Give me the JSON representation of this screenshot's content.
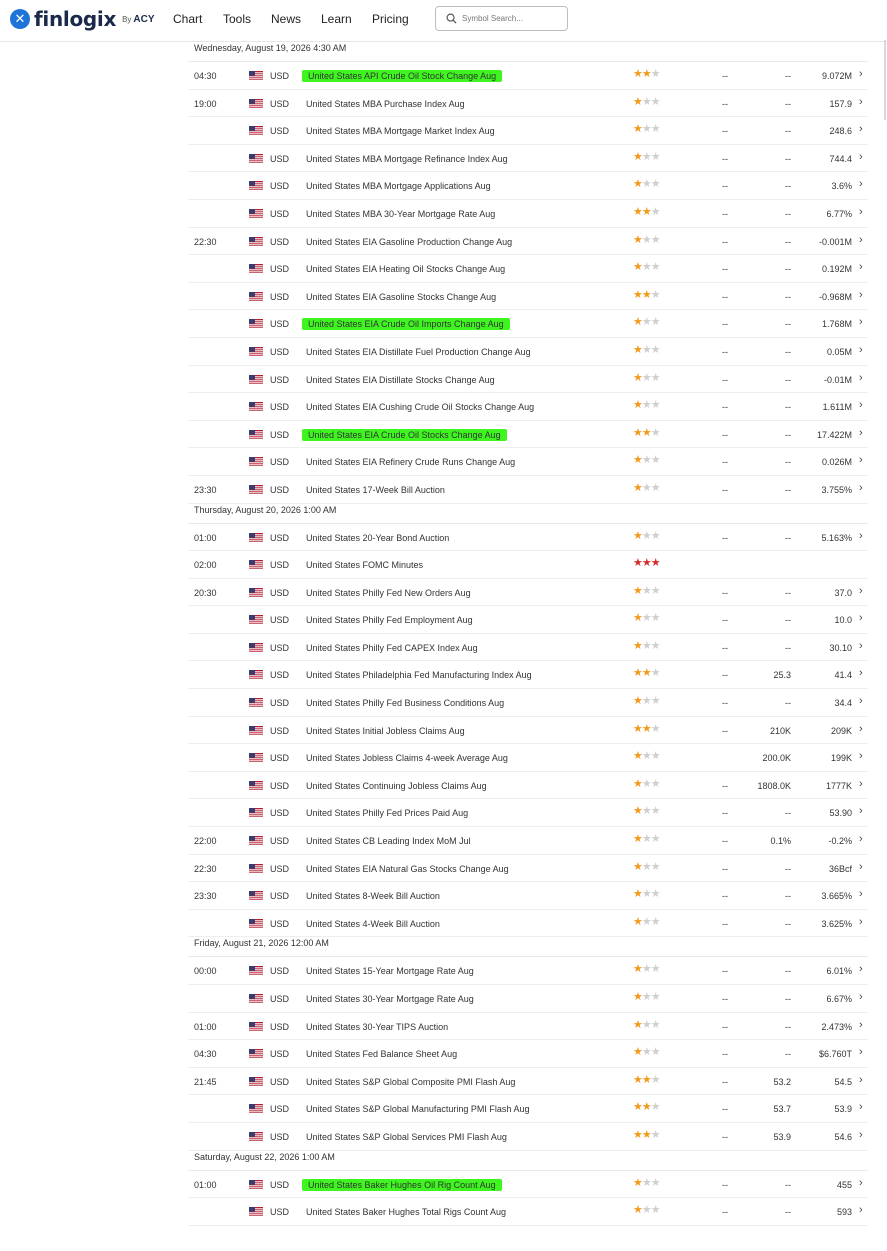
{
  "header": {
    "brand": "finlogix",
    "brand_by": "By",
    "brand_partner": "ACY",
    "nav": [
      "Chart",
      "Tools",
      "News",
      "Learn",
      "Pricing"
    ],
    "search_placeholder": "Symbol Search..."
  },
  "days": [
    {
      "title": "Wednesday, August 19, 2026 4:30 AM",
      "rows": [
        {
          "time": "04:30",
          "cur": "USD",
          "event": "United States API Crude Oil Stock Change Aug",
          "stars": 2,
          "actual": "--",
          "forecast": "--",
          "previous": "9.072M",
          "hl": true
        },
        {
          "time": "19:00",
          "cur": "USD",
          "event": "United States MBA Purchase Index Aug",
          "stars": 1,
          "actual": "--",
          "forecast": "--",
          "previous": "157.9"
        },
        {
          "time": "",
          "cur": "USD",
          "event": "United States MBA Mortgage Market Index Aug",
          "stars": 1,
          "actual": "--",
          "forecast": "--",
          "previous": "248.6"
        },
        {
          "time": "",
          "cur": "USD",
          "event": "United States MBA Mortgage Refinance Index Aug",
          "stars": 1,
          "actual": "--",
          "forecast": "--",
          "previous": "744.4"
        },
        {
          "time": "",
          "cur": "USD",
          "event": "United States MBA Mortgage Applications Aug",
          "stars": 1,
          "actual": "--",
          "forecast": "--",
          "previous": "3.6%"
        },
        {
          "time": "",
          "cur": "USD",
          "event": "United States MBA 30-Year Mortgage Rate Aug",
          "stars": 2,
          "actual": "--",
          "forecast": "--",
          "previous": "6.77%"
        },
        {
          "time": "22:30",
          "cur": "USD",
          "event": "United States EIA Gasoline Production Change Aug",
          "stars": 1,
          "actual": "--",
          "forecast": "--",
          "previous": "-0.001M"
        },
        {
          "time": "",
          "cur": "USD",
          "event": "United States EIA Heating Oil Stocks Change Aug",
          "stars": 1,
          "actual": "--",
          "forecast": "--",
          "previous": "0.192M"
        },
        {
          "time": "",
          "cur": "USD",
          "event": "United States EIA Gasoline Stocks Change Aug",
          "stars": 2,
          "actual": "--",
          "forecast": "--",
          "previous": "-0.968M"
        },
        {
          "time": "",
          "cur": "USD",
          "event": "United States EIA Crude Oil Imports Change Aug",
          "stars": 1,
          "actual": "--",
          "forecast": "--",
          "previous": "1.768M",
          "hl": true
        },
        {
          "time": "",
          "cur": "USD",
          "event": "United States EIA Distillate Fuel Production Change Aug",
          "stars": 1,
          "actual": "--",
          "forecast": "--",
          "previous": "0.05M"
        },
        {
          "time": "",
          "cur": "USD",
          "event": "United States EIA Distillate Stocks Change Aug",
          "stars": 1,
          "actual": "--",
          "forecast": "--",
          "previous": "-0.01M"
        },
        {
          "time": "",
          "cur": "USD",
          "event": "United States EIA Cushing Crude Oil Stocks Change Aug",
          "stars": 1,
          "actual": "--",
          "forecast": "--",
          "previous": "1.611M"
        },
        {
          "time": "",
          "cur": "USD",
          "event": "United States EIA Crude Oil Stocks Change Aug",
          "stars": 2,
          "actual": "--",
          "forecast": "--",
          "previous": "17.422M",
          "hl": true
        },
        {
          "time": "",
          "cur": "USD",
          "event": "United States EIA Refinery Crude Runs Change Aug",
          "stars": 1,
          "actual": "--",
          "forecast": "--",
          "previous": "0.026M"
        },
        {
          "time": "23:30",
          "cur": "USD",
          "event": "United States 17-Week Bill Auction",
          "stars": 1,
          "actual": "--",
          "forecast": "--",
          "previous": "3.755%"
        }
      ]
    },
    {
      "title": "Thursday, August 20, 2026 1:00 AM",
      "rows": [
        {
          "time": "01:00",
          "cur": "USD",
          "event": "United States 20-Year Bond Auction",
          "stars": 1,
          "actual": "--",
          "forecast": "--",
          "previous": "5.163%"
        },
        {
          "time": "02:00",
          "cur": "USD",
          "event": "United States FOMC Minutes",
          "stars": 3,
          "actual": "",
          "forecast": "",
          "previous": "",
          "nochev": true
        },
        {
          "time": "20:30",
          "cur": "USD",
          "event": "United States Philly Fed New Orders Aug",
          "stars": 1,
          "actual": "--",
          "forecast": "--",
          "previous": "37.0"
        },
        {
          "time": "",
          "cur": "USD",
          "event": "United States Philly Fed Employment Aug",
          "stars": 1,
          "actual": "--",
          "forecast": "--",
          "previous": "10.0"
        },
        {
          "time": "",
          "cur": "USD",
          "event": "United States Philly Fed CAPEX Index Aug",
          "stars": 1,
          "actual": "--",
          "forecast": "--",
          "previous": "30.10"
        },
        {
          "time": "",
          "cur": "USD",
          "event": "United States Philadelphia Fed Manufacturing Index Aug",
          "stars": 2,
          "actual": "--",
          "forecast": "25.3",
          "previous": "41.4"
        },
        {
          "time": "",
          "cur": "USD",
          "event": "United States Philly Fed Business Conditions Aug",
          "stars": 1,
          "actual": "--",
          "forecast": "--",
          "previous": "34.4"
        },
        {
          "time": "",
          "cur": "USD",
          "event": "United States Initial Jobless Claims Aug",
          "stars": 2,
          "actual": "--",
          "forecast": "210K",
          "previous": "209K"
        },
        {
          "time": "",
          "cur": "USD",
          "event": "United States Jobless Claims 4-week Average Aug",
          "stars": 1,
          "actual": "",
          "forecast": "200.0K",
          "previous": "199K"
        },
        {
          "time": "",
          "cur": "USD",
          "event": "United States Continuing Jobless Claims Aug",
          "stars": 1,
          "actual": "--",
          "forecast": "1808.0K",
          "previous": "1777K"
        },
        {
          "time": "",
          "cur": "USD",
          "event": "United States Philly Fed Prices Paid Aug",
          "stars": 1,
          "actual": "--",
          "forecast": "--",
          "previous": "53.90"
        },
        {
          "time": "22:00",
          "cur": "USD",
          "event": "United States CB Leading Index MoM Jul",
          "stars": 1,
          "actual": "--",
          "forecast": "0.1%",
          "previous": "-0.2%"
        },
        {
          "time": "22:30",
          "cur": "USD",
          "event": "United States EIA Natural Gas Stocks Change Aug",
          "stars": 1,
          "actual": "--",
          "forecast": "--",
          "previous": "36Bcf"
        },
        {
          "time": "23:30",
          "cur": "USD",
          "event": "United States 8-Week Bill Auction",
          "stars": 1,
          "actual": "--",
          "forecast": "--",
          "previous": "3.665%"
        },
        {
          "time": "",
          "cur": "USD",
          "event": "United States 4-Week Bill Auction",
          "stars": 1,
          "actual": "--",
          "forecast": "--",
          "previous": "3.625%"
        }
      ]
    },
    {
      "title": "Friday, August 21, 2026 12:00 AM",
      "rows": [
        {
          "time": "00:00",
          "cur": "USD",
          "event": "United States 15-Year Mortgage Rate Aug",
          "stars": 1,
          "actual": "--",
          "forecast": "--",
          "previous": "6.01%"
        },
        {
          "time": "",
          "cur": "USD",
          "event": "United States 30-Year Mortgage Rate Aug",
          "stars": 1,
          "actual": "--",
          "forecast": "--",
          "previous": "6.67%"
        },
        {
          "time": "01:00",
          "cur": "USD",
          "event": "United States 30-Year TIPS Auction",
          "stars": 1,
          "actual": "--",
          "forecast": "--",
          "previous": "2.473%"
        },
        {
          "time": "04:30",
          "cur": "USD",
          "event": "United States Fed Balance Sheet Aug",
          "stars": 1,
          "actual": "--",
          "forecast": "--",
          "previous": "$6.760T"
        },
        {
          "time": "21:45",
          "cur": "USD",
          "event": "United States S&P Global Composite PMI Flash Aug",
          "stars": 2,
          "actual": "--",
          "forecast": "53.2",
          "previous": "54.5"
        },
        {
          "time": "",
          "cur": "USD",
          "event": "United States S&P Global Manufacturing PMI Flash Aug",
          "stars": 2,
          "actual": "--",
          "forecast": "53.7",
          "previous": "53.9"
        },
        {
          "time": "",
          "cur": "USD",
          "event": "United States S&P Global Services PMI Flash Aug",
          "stars": 2,
          "actual": "--",
          "forecast": "53.9",
          "previous": "54.6"
        }
      ]
    },
    {
      "title": "Saturday, August 22, 2026 1:00 AM",
      "rows": [
        {
          "time": "01:00",
          "cur": "USD",
          "event": "United States Baker Hughes Oil Rig Count Aug",
          "stars": 1,
          "actual": "--",
          "forecast": "--",
          "previous": "455",
          "hl": true
        },
        {
          "time": "",
          "cur": "USD",
          "event": "United States Baker Hughes Total Rigs Count Aug",
          "stars": 1,
          "actual": "--",
          "forecast": "--",
          "previous": "593"
        }
      ]
    }
  ],
  "colors": {
    "highlight": "#3ef51f",
    "star_on": "#f29a1a",
    "star_off": "#cfcfcf",
    "star_high": "#d42c2c",
    "brand": "#1e74d6"
  }
}
